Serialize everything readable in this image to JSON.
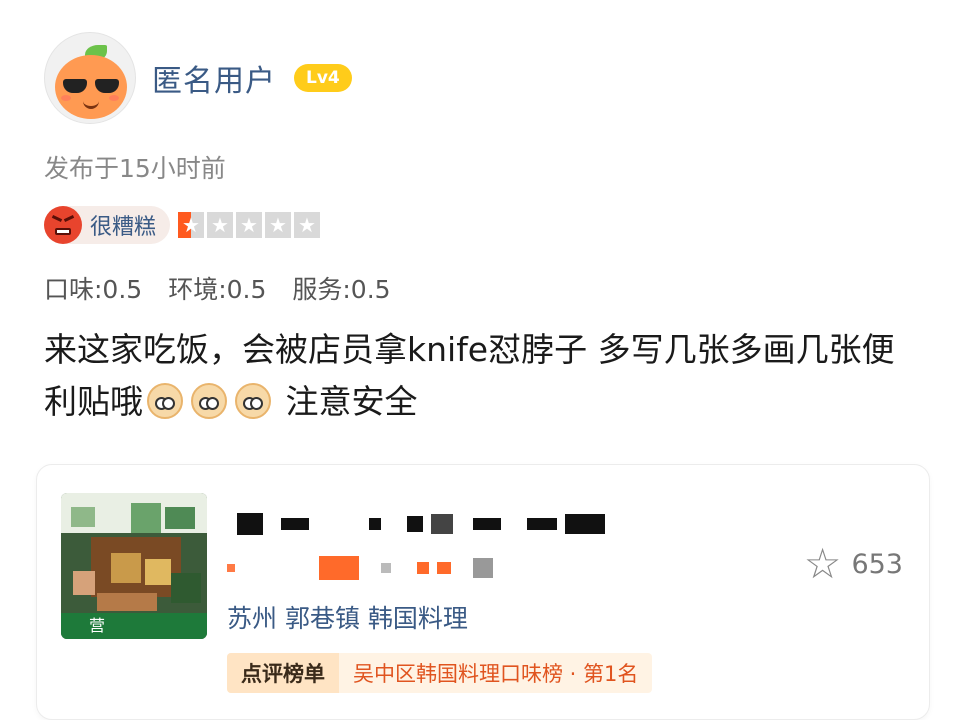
{
  "user": {
    "name": "匿名用户",
    "level": "Lv4",
    "avatar_icon": "sunglasses-orange-avatar"
  },
  "post": {
    "time": "发布于15小时前",
    "mood": "很糟糕",
    "mood_icon": "angry-face-icon",
    "star_rating": 0.5,
    "star_max": 5,
    "scores": [
      "口味:0.5",
      "环境:0.5",
      "服务:0.5"
    ],
    "content_part1": "来这家吃饭，会被店员拿knife怼脖子 多写几张多画几张便利贴哦",
    "content_part2": " 注意安全",
    "emoji_icon": "melon-face-emoji"
  },
  "shop": {
    "thumb_tag": "营",
    "location": "苏州 郭巷镇 韩国料理",
    "favorite_count": "653",
    "rank_label": "点评榜单",
    "rank_text": "吴中区韩国料理口味榜 · 第1名"
  },
  "colors": {
    "link_blue": "#3a5a85",
    "level_yellow": "#ffcc1a",
    "star_orange": "#ff5a1f",
    "rank_orange": "#e0541f"
  }
}
